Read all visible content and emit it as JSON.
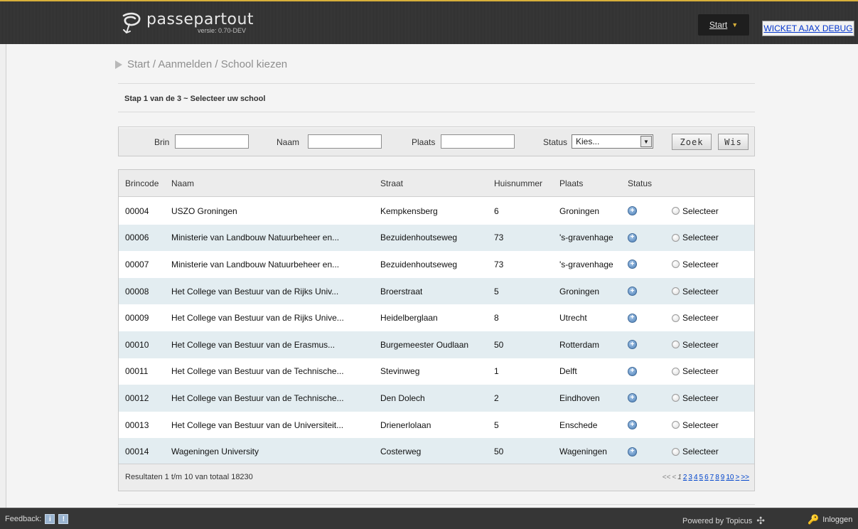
{
  "header": {
    "brand": "passepartout",
    "version": "versie: 0.70-DEV",
    "start_menu": "Start",
    "debug_link": "WICKET AJAX DEBUG"
  },
  "breadcrumb": "Start / Aanmelden / School kiezen",
  "step": "Stap 1 van de 3 ~ Selecteer uw school",
  "filter": {
    "brin_label": "Brin",
    "brin_value": "",
    "naam_label": "Naam",
    "naam_value": "",
    "plaats_label": "Plaats",
    "plaats_value": "",
    "status_label": "Status",
    "status_selected": "Kies...",
    "search_button": "Zoek",
    "clear_button": "Wis"
  },
  "table": {
    "columns": [
      "Brincode",
      "Naam",
      "Straat",
      "Huisnummer",
      "Plaats",
      "Status",
      ""
    ],
    "select_label": "Selecteer",
    "rows": [
      {
        "brin": "00004",
        "naam": "USZO Groningen",
        "straat": "Kempkensberg",
        "huis": "6",
        "plaats": "Groningen"
      },
      {
        "brin": "00006",
        "naam": "Ministerie van Landbouw Natuurbeheer en...",
        "straat": "Bezuidenhoutseweg",
        "huis": "73",
        "plaats": "'s-gravenhage"
      },
      {
        "brin": "00007",
        "naam": "Ministerie van Landbouw Natuurbeheer en...",
        "straat": "Bezuidenhoutseweg",
        "huis": "73",
        "plaats": "'s-gravenhage"
      },
      {
        "brin": "00008",
        "naam": "Het College van Bestuur van de Rijks Univ...",
        "straat": "Broerstraat",
        "huis": "5",
        "plaats": "Groningen"
      },
      {
        "brin": "00009",
        "naam": "Het College van Bestuur van de Rijks Unive...",
        "straat": "Heidelberglaan",
        "huis": "8",
        "plaats": "Utrecht"
      },
      {
        "brin": "00010",
        "naam": "Het College van Bestuur van de Erasmus...",
        "straat": "Burgemeester Oudlaan",
        "huis": "50",
        "plaats": "Rotterdam"
      },
      {
        "brin": "00011",
        "naam": "Het College van Bestuur van de Technische...",
        "straat": "Stevinweg",
        "huis": "1",
        "plaats": "Delft"
      },
      {
        "brin": "00012",
        "naam": "Het College van Bestuur van de Technische...",
        "straat": "Den Dolech",
        "huis": "2",
        "plaats": "Eindhoven"
      },
      {
        "brin": "00013",
        "naam": "Het College van Bestuur van de Universiteit...",
        "straat": "Drienerlolaan",
        "huis": "5",
        "plaats": "Enschede"
      },
      {
        "brin": "00014",
        "naam": "Wageningen University",
        "straat": "Costerweg",
        "huis": "50",
        "plaats": "Wageningen"
      }
    ],
    "results_text": "Resultaten 1 t/m 10 van totaal 18230",
    "pager": {
      "first": "<<",
      "prev": "<",
      "current": "1",
      "pages": [
        "2",
        "3",
        "4",
        "5",
        "6",
        "7",
        "8",
        "9",
        "10"
      ],
      "next": ">",
      "last": ">>"
    }
  },
  "footer": {
    "feedback_label": "Feedback:",
    "powered_by": "Powered by Topicus",
    "login": "Inloggen"
  },
  "icons": {
    "status": "plus-circle-icon",
    "select": "radio-icon",
    "login": "key-icon",
    "brand_mark": "passepartout-logo-icon"
  },
  "colors": {
    "accent_gold": "#d8b03a",
    "row_stripe": "#e3edf1",
    "link_blue": "#0044cc",
    "topbar": "#333333"
  }
}
